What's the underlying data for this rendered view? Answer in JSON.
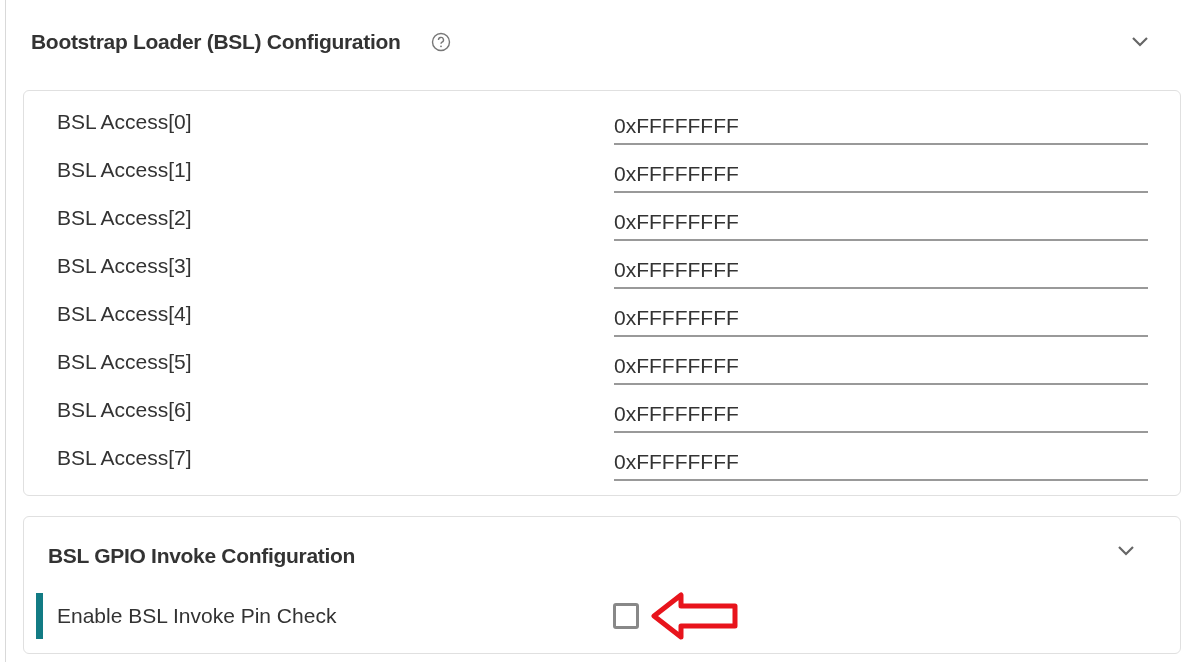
{
  "section": {
    "title": "Bootstrap Loader (BSL) Configuration",
    "fields": [
      {
        "label": "BSL Access[0]",
        "value": "0xFFFFFFFF"
      },
      {
        "label": "BSL Access[1]",
        "value": "0xFFFFFFFF"
      },
      {
        "label": "BSL Access[2]",
        "value": "0xFFFFFFFF"
      },
      {
        "label": "BSL Access[3]",
        "value": "0xFFFFFFFF"
      },
      {
        "label": "BSL Access[4]",
        "value": "0xFFFFFFFF"
      },
      {
        "label": "BSL Access[5]",
        "value": "0xFFFFFFFF"
      },
      {
        "label": "BSL Access[6]",
        "value": "0xFFFFFFFF"
      },
      {
        "label": "BSL Access[7]",
        "value": "0xFFFFFFFF"
      }
    ]
  },
  "subsection": {
    "title": "BSL GPIO Invoke Configuration",
    "options": [
      {
        "label": "Enable BSL Invoke Pin Check",
        "checked": false
      }
    ]
  }
}
